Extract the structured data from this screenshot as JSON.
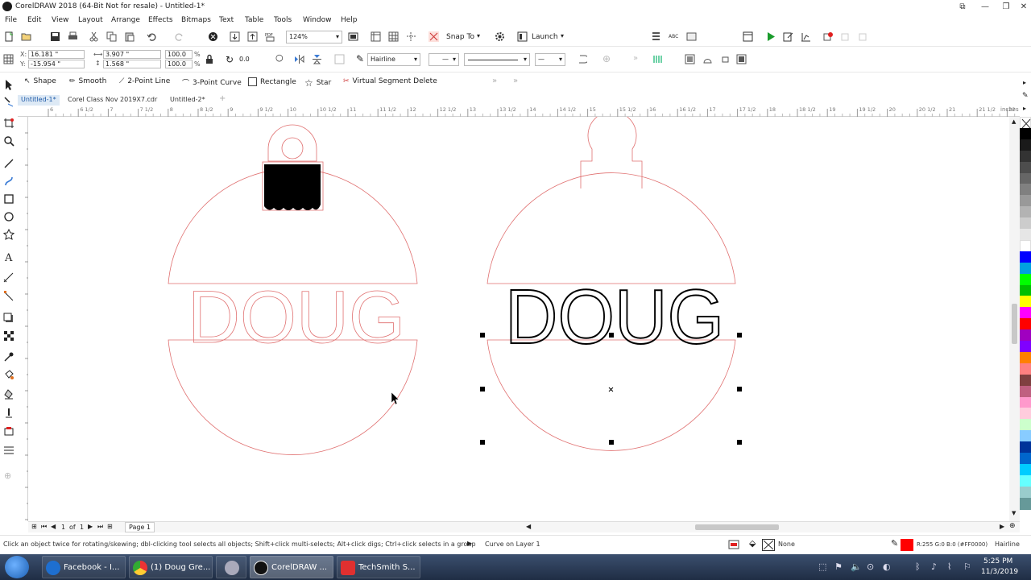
{
  "window": {
    "title": "CorelDRAW 2018 (64-Bit Not for resale) - Untitled-1*",
    "minimize": "—",
    "restore": "❐",
    "close": "✕",
    "extra": "⧉"
  },
  "menus": [
    "File",
    "Edit",
    "View",
    "Layout",
    "Arrange",
    "Effects",
    "Bitmaps",
    "Text",
    "Table",
    "Tools",
    "Window",
    "Help"
  ],
  "toolbar": {
    "zoom": "124%",
    "snap_to": "Snap To",
    "launch": "Launch"
  },
  "property_bar": {
    "x": "16.181 \"",
    "y": "-15.954 \"",
    "width": "3.907 \"",
    "height": "1.568 \"",
    "scale_w": "100.0",
    "scale_h": "100.0",
    "percent": "%",
    "rotation": "0.0",
    "outline": "Hairline"
  },
  "shape_tools": [
    "Shape",
    "Smooth",
    "2-Point Line",
    "3-Point Curve",
    "Rectangle",
    "Star",
    "Virtual Segment Delete"
  ],
  "doc_tabs": [
    "Untitled-1*",
    "Corel Class Nov 2019X7.cdr",
    "Untitled-2*"
  ],
  "ruler": {
    "labels": [
      "6",
      "6 1/2",
      "7",
      "7 1/2",
      "8",
      "8 1/2",
      "9",
      "9 1/2",
      "10",
      "10 1/2",
      "11",
      "11 1/2",
      "12",
      "12 1/2",
      "13",
      "13 1/2",
      "14",
      "14 1/2",
      "15",
      "15 1/2",
      "16",
      "16 1/2",
      "17",
      "17 1/2",
      "18",
      "18 1/2",
      "19",
      "19 1/2",
      "20",
      "20 1/2",
      "21",
      "21 1/2",
      "22"
    ],
    "unit": "inches"
  },
  "canvas": {
    "text_left": "DOUG",
    "text_right": "DOUG"
  },
  "page_nav": {
    "current": "1",
    "of": "of",
    "total": "1",
    "page_tab": "Page 1"
  },
  "status": {
    "hint": "Click an object twice for rotating/skewing; dbl-clicking tool selects all objects; Shift+click multi-selects; Alt+click digs; Ctrl+click selects in a group",
    "object": "Curve on Layer 1",
    "fill": "None",
    "outline_color": "R:255 G:0 B:0 (#FF0000)",
    "outline_width": "Hairline"
  },
  "taskbar": {
    "items": [
      "Facebook - I...",
      "(1) Doug Gre...",
      "",
      "CorelDRAW ...",
      "TechSmith S..."
    ],
    "time": "5:25 PM",
    "date": "11/3/2019"
  },
  "palette_colors": [
    "#ffffff",
    "#000000",
    "#1a1a1a",
    "#333333",
    "#4d4d4d",
    "#666666",
    "#808080",
    "#999999",
    "#b3b3b3",
    "#cccccc",
    "#e6e6e6",
    "#ffffff",
    "#0000ff",
    "#00a0e0",
    "#00ff00",
    "#00c000",
    "#ffff00",
    "#ff00ff",
    "#ff0000",
    "#a000c0",
    "#8000ff",
    "#ff8000",
    "#ff8080",
    "#804040",
    "#c06080",
    "#ff99cc",
    "#ffccdd",
    "#ccffcc",
    "#88ccff",
    "#003399",
    "#0066cc",
    "#00ccff",
    "#66ffff",
    "#99cccc",
    "#669999"
  ],
  "colors": {
    "accent": "#1e5aa8",
    "cut_line": "#e06060",
    "red": "#ff0000"
  }
}
